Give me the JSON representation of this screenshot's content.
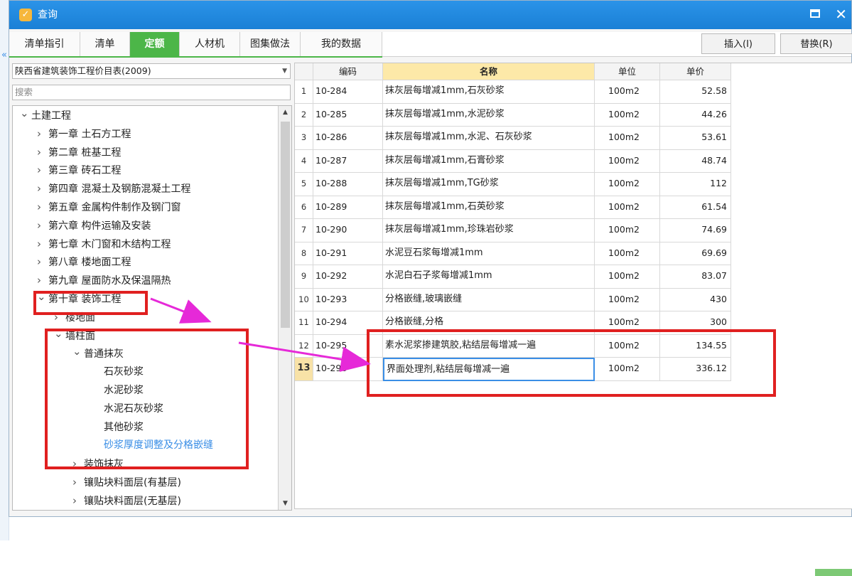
{
  "window": {
    "title": "查询",
    "close_glyph": "✕"
  },
  "tabs": [
    {
      "label": "清单指引",
      "active": false
    },
    {
      "label": "清单",
      "active": false
    },
    {
      "label": "定额",
      "active": true
    },
    {
      "label": "人材机",
      "active": false
    },
    {
      "label": "图集做法",
      "active": false
    },
    {
      "label": "我的数据",
      "active": false
    }
  ],
  "toolbar": {
    "insert_label": "插入(I)",
    "replace_label": "替换(R)"
  },
  "library": {
    "selected": "陕西省建筑装饰工程价目表(2009)"
  },
  "search": {
    "placeholder": "搜索"
  },
  "tree": [
    {
      "label": "土建工程",
      "level": 0,
      "arrow": "v"
    },
    {
      "label": "第一章 土石方工程",
      "level": 1,
      "arrow": ">"
    },
    {
      "label": "第二章 桩基工程",
      "level": 1,
      "arrow": ">"
    },
    {
      "label": "第三章 砖石工程",
      "level": 1,
      "arrow": ">"
    },
    {
      "label": "第四章 混凝土及钢筋混凝土工程",
      "level": 1,
      "arrow": ">"
    },
    {
      "label": "第五章 金属构件制作及钢门窗",
      "level": 1,
      "arrow": ">"
    },
    {
      "label": "第六章 构件运输及安装",
      "level": 1,
      "arrow": ">"
    },
    {
      "label": "第七章 木门窗和木结构工程",
      "level": 1,
      "arrow": ">"
    },
    {
      "label": "第八章 楼地面工程",
      "level": 1,
      "arrow": ">"
    },
    {
      "label": "第九章 屋面防水及保温隔热",
      "level": 1,
      "arrow": ">"
    },
    {
      "label": "第十章 装饰工程",
      "level": 1,
      "arrow": "v"
    },
    {
      "label": "楼地面",
      "level": 2,
      "arrow": ">"
    },
    {
      "label": "墙柱面",
      "level": 2,
      "arrow": "v"
    },
    {
      "label": "普通抹灰",
      "level": 3,
      "arrow": "v"
    },
    {
      "label": "石灰砂浆",
      "level": 4,
      "arrow": ""
    },
    {
      "label": "水泥砂浆",
      "level": 4,
      "arrow": ""
    },
    {
      "label": "水泥石灰砂浆",
      "level": 4,
      "arrow": ""
    },
    {
      "label": "其他砂浆",
      "level": 4,
      "arrow": ""
    },
    {
      "label": "砂浆厚度调整及分格嵌缝",
      "level": 4,
      "arrow": "",
      "selected": true
    },
    {
      "label": "装饰抹灰",
      "level": 3,
      "arrow": ">"
    },
    {
      "label": "镶贴块料面层(有基层)",
      "level": 3,
      "arrow": ">"
    },
    {
      "label": "镶贴块料面层(无基层)",
      "level": 3,
      "arrow": ">"
    }
  ],
  "table": {
    "columns": [
      "编码",
      "名称",
      "单位",
      "单价"
    ],
    "rows": [
      {
        "n": "1",
        "code": "10-284",
        "name": "抹灰层每增减1mm,石灰砂浆",
        "unit": "100m2",
        "price": "52.58"
      },
      {
        "n": "2",
        "code": "10-285",
        "name": "抹灰层每增减1mm,水泥砂浆",
        "unit": "100m2",
        "price": "44.26"
      },
      {
        "n": "3",
        "code": "10-286",
        "name": "抹灰层每增减1mm,水泥、石灰砂浆",
        "unit": "100m2",
        "price": "53.61"
      },
      {
        "n": "4",
        "code": "10-287",
        "name": "抹灰层每增减1mm,石膏砂浆",
        "unit": "100m2",
        "price": "48.74"
      },
      {
        "n": "5",
        "code": "10-288",
        "name": "抹灰层每增减1mm,TG砂浆",
        "unit": "100m2",
        "price": "112"
      },
      {
        "n": "6",
        "code": "10-289",
        "name": "抹灰层每增减1mm,石英砂浆",
        "unit": "100m2",
        "price": "61.54"
      },
      {
        "n": "7",
        "code": "10-290",
        "name": "抹灰层每增减1mm,珍珠岩砂浆",
        "unit": "100m2",
        "price": "74.69"
      },
      {
        "n": "8",
        "code": "10-291",
        "name": "水泥豆石浆每增减1mm",
        "unit": "100m2",
        "price": "69.69"
      },
      {
        "n": "9",
        "code": "10-292",
        "name": "水泥白石子浆每增减1mm",
        "unit": "100m2",
        "price": "83.07"
      },
      {
        "n": "10",
        "code": "10-293",
        "name": "分格嵌缝,玻璃嵌缝",
        "unit": "100m2",
        "price": "430"
      },
      {
        "n": "11",
        "code": "10-294",
        "name": "分格嵌缝,分格",
        "unit": "100m2",
        "price": "300"
      },
      {
        "n": "12",
        "code": "10-295",
        "name": "素水泥浆掺建筑胶,粘结层每增减一遍",
        "unit": "100m2",
        "price": "134.55"
      },
      {
        "n": "13",
        "code": "10-296",
        "name": "界面处理剂,粘结层每增减一遍",
        "unit": "100m2",
        "price": "336.12",
        "current": true
      }
    ]
  },
  "annotation_color": "#e02020",
  "arrow_color": "#e629d8",
  "accent_green": "#4cb648",
  "title_blue": "#1f88dc"
}
